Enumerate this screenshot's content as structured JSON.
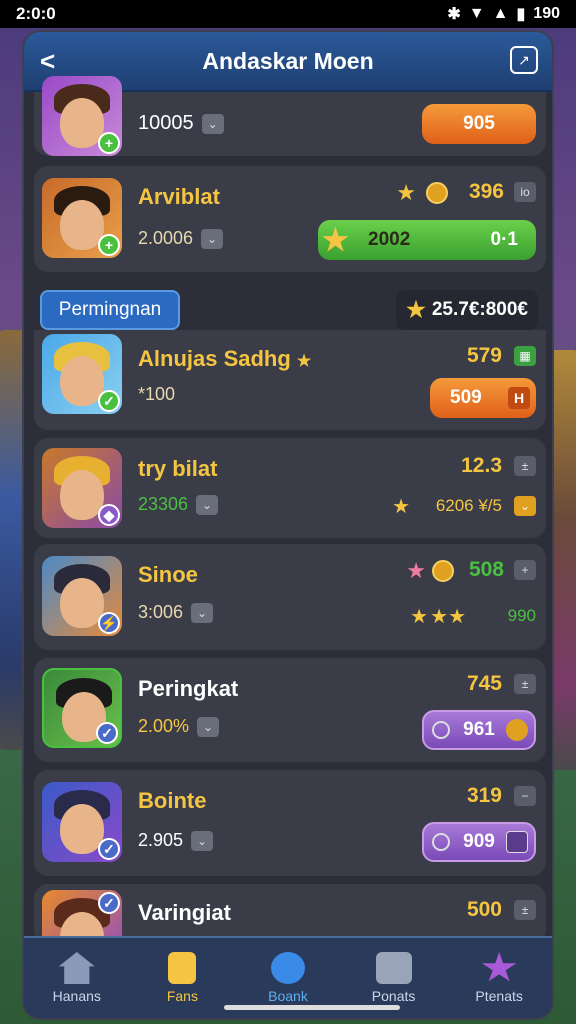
{
  "status": {
    "time": "2:0:0",
    "battery": "190"
  },
  "header": {
    "title": "Andaskar Moen"
  },
  "rows": [
    {
      "name": "",
      "sub": "10005",
      "value": "",
      "button": "905"
    },
    {
      "name": "Arviblat",
      "sub": "2.0006",
      "value": "396",
      "button_left": "2002",
      "button_right": "0·1"
    },
    {
      "name": "Alnujas Sadhg",
      "sub": "*100",
      "value": "579",
      "button": "509"
    },
    {
      "name": "try bilat",
      "sub": "23306",
      "value": "12.3",
      "extra": "6206 ¥/5"
    },
    {
      "name": "Sinoe",
      "sub": "3:006",
      "value": "508",
      "extra": "990"
    },
    {
      "name": "Peringkat",
      "sub": "2.00%",
      "value": "745",
      "button": "961"
    },
    {
      "name": "Bointe",
      "sub": "2.905",
      "value": "319",
      "button": "909"
    },
    {
      "name": "Varingiat",
      "sub": "",
      "value": "500"
    }
  ],
  "section": {
    "label": "Permingnan",
    "score": "25.7€:800€"
  },
  "nav": [
    {
      "label": "Hanans",
      "icon": "home-icon"
    },
    {
      "label": "Fans",
      "icon": "lock-icon"
    },
    {
      "label": "Boank",
      "icon": "planet-icon"
    },
    {
      "label": "Ponats",
      "icon": "chat-icon"
    },
    {
      "label": "Ptenats",
      "icon": "star-icon"
    }
  ],
  "colors": {
    "header": "#2b5a9a",
    "panel": "#2c2f3a",
    "row": "#3a3d48",
    "orange": "#f07a2a",
    "green": "#4ac040",
    "purple": "#8a5ac8",
    "gold": "#f5c542"
  }
}
